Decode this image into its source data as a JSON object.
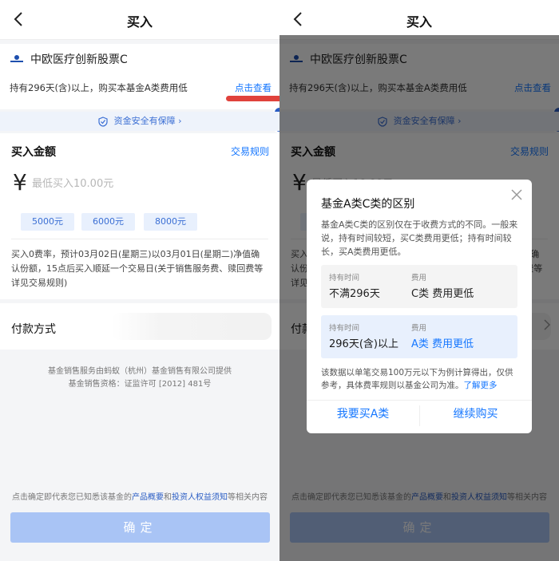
{
  "nav": {
    "title": "买入"
  },
  "fund": {
    "name": "中欧医疗创新股票C",
    "note": "持有296天(含)以上，购买本基金A类费用低",
    "link": "点击查看"
  },
  "safe": {
    "text": "资金安全有保障 ›"
  },
  "buy": {
    "label": "买入金额",
    "rules": "交易规则",
    "currency": "¥",
    "placeholder": "最低买入10.00元",
    "chips": [
      "5000元",
      "6000元",
      "8000元"
    ],
    "desc": "买入0费率，预计03月02日(星期三)以03月01日(星期二)净值确认份额，15点后买入顺延一个交易日(关于销售服务费、赎回费等详见交易规则)"
  },
  "pay": {
    "label": "付款方式"
  },
  "footer": {
    "line1": "基金销售服务由蚂蚁（杭州）基金销售有限公司提供",
    "line2": "基金销售资格：证监许可 [2012] 481号"
  },
  "agree": {
    "prefix": "点击确定即代表您已知悉该基金的",
    "link1": "产品概要",
    "and": "和",
    "link2": "投资人权益须知",
    "suffix": "等相关内容"
  },
  "confirm": {
    "label": "确定"
  },
  "modal": {
    "title": "基金A类C类的区别",
    "desc": "基金A类C类的区别仅在于收费方式的不同。一般来说，持有时间较短，买C类费用更低；持有时间较长，买A类费用更低。",
    "hold_label": "持有时间",
    "fee_label": "费用",
    "c_hold": "不满296天",
    "c_fee": "C类 费用更低",
    "a_hold": "296天(含)以上",
    "a_fee": "A类 费用更低",
    "note": "该数据以单笔交易100万元以下为例计算得出，仅供参考，具体费率规则以基金公司为准。",
    "more": "了解更多",
    "btn_a": "我要买A类",
    "btn_continue": "继续购买"
  },
  "colors": {
    "accent": "#1677ff",
    "highlight": "#e0423c",
    "confirm_disabled": "#a9c4f5"
  }
}
